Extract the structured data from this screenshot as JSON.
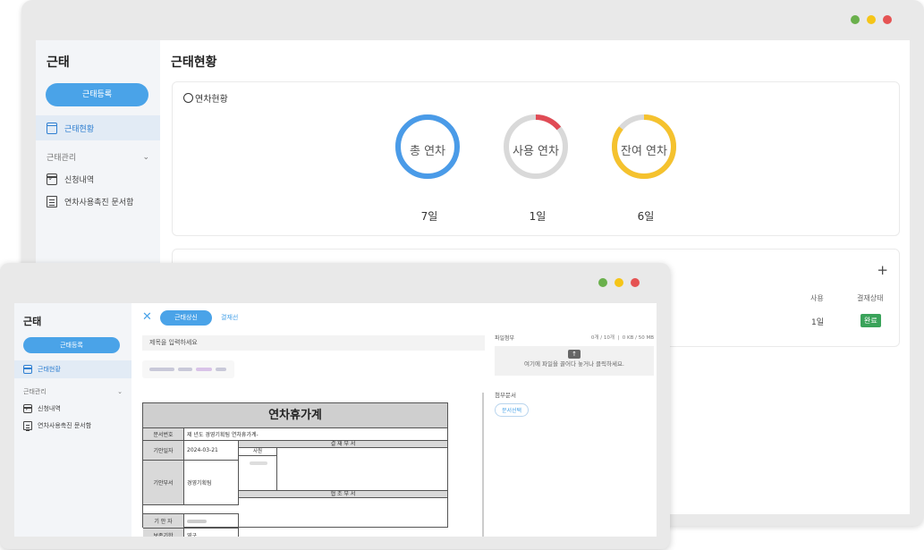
{
  "back": {
    "sidebar": {
      "title": "근태",
      "register_btn": "근태등록",
      "active_item": "근태현황",
      "group": "근태관리",
      "items": [
        "신청내역",
        "연차사용촉진 문서함"
      ]
    },
    "main": {
      "title": "근태현황",
      "card_title": "연차현황",
      "rings": [
        {
          "label": "총 연차",
          "value": "7일",
          "color": "#4a9be8",
          "used_fraction": 1.0
        },
        {
          "label": "사용 연차",
          "value": "1일",
          "color": "#e04b55",
          "used_fraction": 0.1429
        },
        {
          "label": "잔여 연차",
          "value": "6일",
          "color": "#f5c22e",
          "used_fraction": 0.8571
        }
      ],
      "table": {
        "plus": "+",
        "headers": [
          "사용",
          "결재상태"
        ],
        "row": {
          "used": "1일",
          "status": "완료"
        }
      }
    }
  },
  "front": {
    "sidebar": {
      "title": "근태",
      "register_btn": "근태등록",
      "active_item": "근태현황",
      "group": "근태관리",
      "items": [
        "신청내역",
        "연차사용촉진 문서함"
      ]
    },
    "editor": {
      "close": "✕",
      "tab_active": "근태상신",
      "tab_other": "결재선",
      "title_placeholder": "제목을 입력하세요",
      "doc": {
        "title": "연차휴가계",
        "doc_no_label": "문서번호",
        "doc_no_value": "제 년도 경영기획팀 연차휴가계-",
        "date_label": "기안일자",
        "date_value": "2024-03-21",
        "approval_header": "결 재 부 서",
        "approver_role": "사원",
        "dept_label": "기안부서",
        "dept_value": "경영기획팀",
        "coop_header": "협 조 부 서",
        "drafter_label": "기 안 자",
        "keep_label": "보존기한",
        "keep_value": "영구"
      },
      "attach": {
        "label": "파일첨부",
        "count": "0개 / 10개",
        "size": "0 KB / 50 MB",
        "drop_text": "여기에 파일을 끌어다 놓거나 클릭하세요.",
        "doc_label": "첨부문서",
        "doc_btn": "문서선택"
      }
    }
  }
}
